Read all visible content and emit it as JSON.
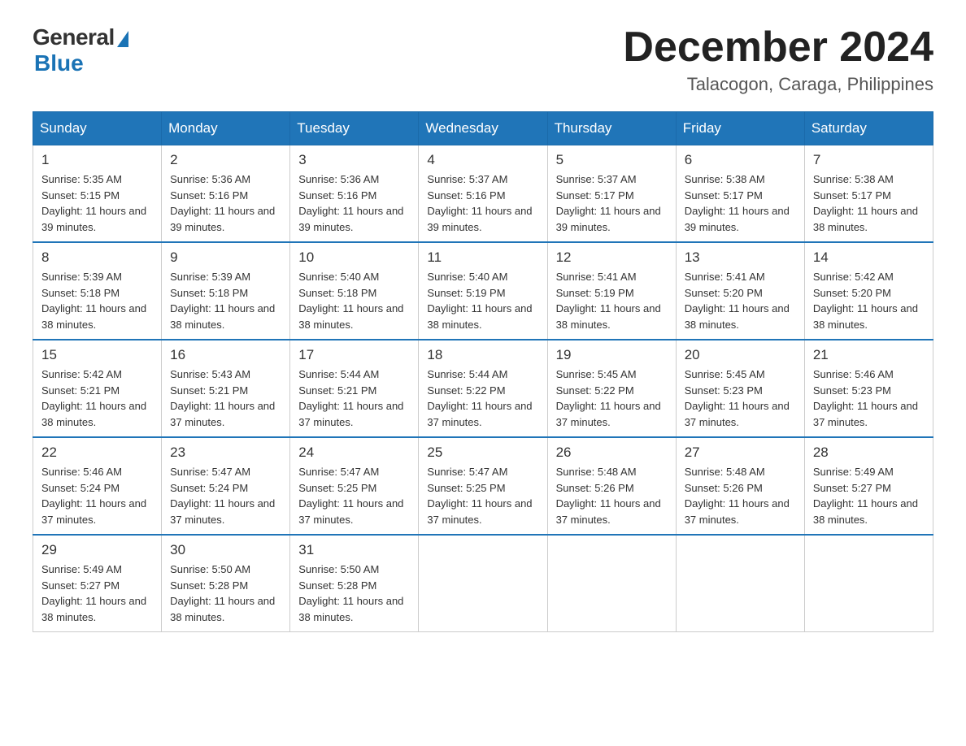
{
  "logo": {
    "general": "General",
    "blue": "Blue"
  },
  "title": "December 2024",
  "location": "Talacogon, Caraga, Philippines",
  "days_of_week": [
    "Sunday",
    "Monday",
    "Tuesday",
    "Wednesday",
    "Thursday",
    "Friday",
    "Saturday"
  ],
  "weeks": [
    [
      {
        "day": "1",
        "sunrise": "5:35 AM",
        "sunset": "5:15 PM",
        "daylight": "11 hours and 39 minutes."
      },
      {
        "day": "2",
        "sunrise": "5:36 AM",
        "sunset": "5:16 PM",
        "daylight": "11 hours and 39 minutes."
      },
      {
        "day": "3",
        "sunrise": "5:36 AM",
        "sunset": "5:16 PM",
        "daylight": "11 hours and 39 minutes."
      },
      {
        "day": "4",
        "sunrise": "5:37 AM",
        "sunset": "5:16 PM",
        "daylight": "11 hours and 39 minutes."
      },
      {
        "day": "5",
        "sunrise": "5:37 AM",
        "sunset": "5:17 PM",
        "daylight": "11 hours and 39 minutes."
      },
      {
        "day": "6",
        "sunrise": "5:38 AM",
        "sunset": "5:17 PM",
        "daylight": "11 hours and 39 minutes."
      },
      {
        "day": "7",
        "sunrise": "5:38 AM",
        "sunset": "5:17 PM",
        "daylight": "11 hours and 38 minutes."
      }
    ],
    [
      {
        "day": "8",
        "sunrise": "5:39 AM",
        "sunset": "5:18 PM",
        "daylight": "11 hours and 38 minutes."
      },
      {
        "day": "9",
        "sunrise": "5:39 AM",
        "sunset": "5:18 PM",
        "daylight": "11 hours and 38 minutes."
      },
      {
        "day": "10",
        "sunrise": "5:40 AM",
        "sunset": "5:18 PM",
        "daylight": "11 hours and 38 minutes."
      },
      {
        "day": "11",
        "sunrise": "5:40 AM",
        "sunset": "5:19 PM",
        "daylight": "11 hours and 38 minutes."
      },
      {
        "day": "12",
        "sunrise": "5:41 AM",
        "sunset": "5:19 PM",
        "daylight": "11 hours and 38 minutes."
      },
      {
        "day": "13",
        "sunrise": "5:41 AM",
        "sunset": "5:20 PM",
        "daylight": "11 hours and 38 minutes."
      },
      {
        "day": "14",
        "sunrise": "5:42 AM",
        "sunset": "5:20 PM",
        "daylight": "11 hours and 38 minutes."
      }
    ],
    [
      {
        "day": "15",
        "sunrise": "5:42 AM",
        "sunset": "5:21 PM",
        "daylight": "11 hours and 38 minutes."
      },
      {
        "day": "16",
        "sunrise": "5:43 AM",
        "sunset": "5:21 PM",
        "daylight": "11 hours and 37 minutes."
      },
      {
        "day": "17",
        "sunrise": "5:44 AM",
        "sunset": "5:21 PM",
        "daylight": "11 hours and 37 minutes."
      },
      {
        "day": "18",
        "sunrise": "5:44 AM",
        "sunset": "5:22 PM",
        "daylight": "11 hours and 37 minutes."
      },
      {
        "day": "19",
        "sunrise": "5:45 AM",
        "sunset": "5:22 PM",
        "daylight": "11 hours and 37 minutes."
      },
      {
        "day": "20",
        "sunrise": "5:45 AM",
        "sunset": "5:23 PM",
        "daylight": "11 hours and 37 minutes."
      },
      {
        "day": "21",
        "sunrise": "5:46 AM",
        "sunset": "5:23 PM",
        "daylight": "11 hours and 37 minutes."
      }
    ],
    [
      {
        "day": "22",
        "sunrise": "5:46 AM",
        "sunset": "5:24 PM",
        "daylight": "11 hours and 37 minutes."
      },
      {
        "day": "23",
        "sunrise": "5:47 AM",
        "sunset": "5:24 PM",
        "daylight": "11 hours and 37 minutes."
      },
      {
        "day": "24",
        "sunrise": "5:47 AM",
        "sunset": "5:25 PM",
        "daylight": "11 hours and 37 minutes."
      },
      {
        "day": "25",
        "sunrise": "5:47 AM",
        "sunset": "5:25 PM",
        "daylight": "11 hours and 37 minutes."
      },
      {
        "day": "26",
        "sunrise": "5:48 AM",
        "sunset": "5:26 PM",
        "daylight": "11 hours and 37 minutes."
      },
      {
        "day": "27",
        "sunrise": "5:48 AM",
        "sunset": "5:26 PM",
        "daylight": "11 hours and 37 minutes."
      },
      {
        "day": "28",
        "sunrise": "5:49 AM",
        "sunset": "5:27 PM",
        "daylight": "11 hours and 38 minutes."
      }
    ],
    [
      {
        "day": "29",
        "sunrise": "5:49 AM",
        "sunset": "5:27 PM",
        "daylight": "11 hours and 38 minutes."
      },
      {
        "day": "30",
        "sunrise": "5:50 AM",
        "sunset": "5:28 PM",
        "daylight": "11 hours and 38 minutes."
      },
      {
        "day": "31",
        "sunrise": "5:50 AM",
        "sunset": "5:28 PM",
        "daylight": "11 hours and 38 minutes."
      },
      null,
      null,
      null,
      null
    ]
  ]
}
